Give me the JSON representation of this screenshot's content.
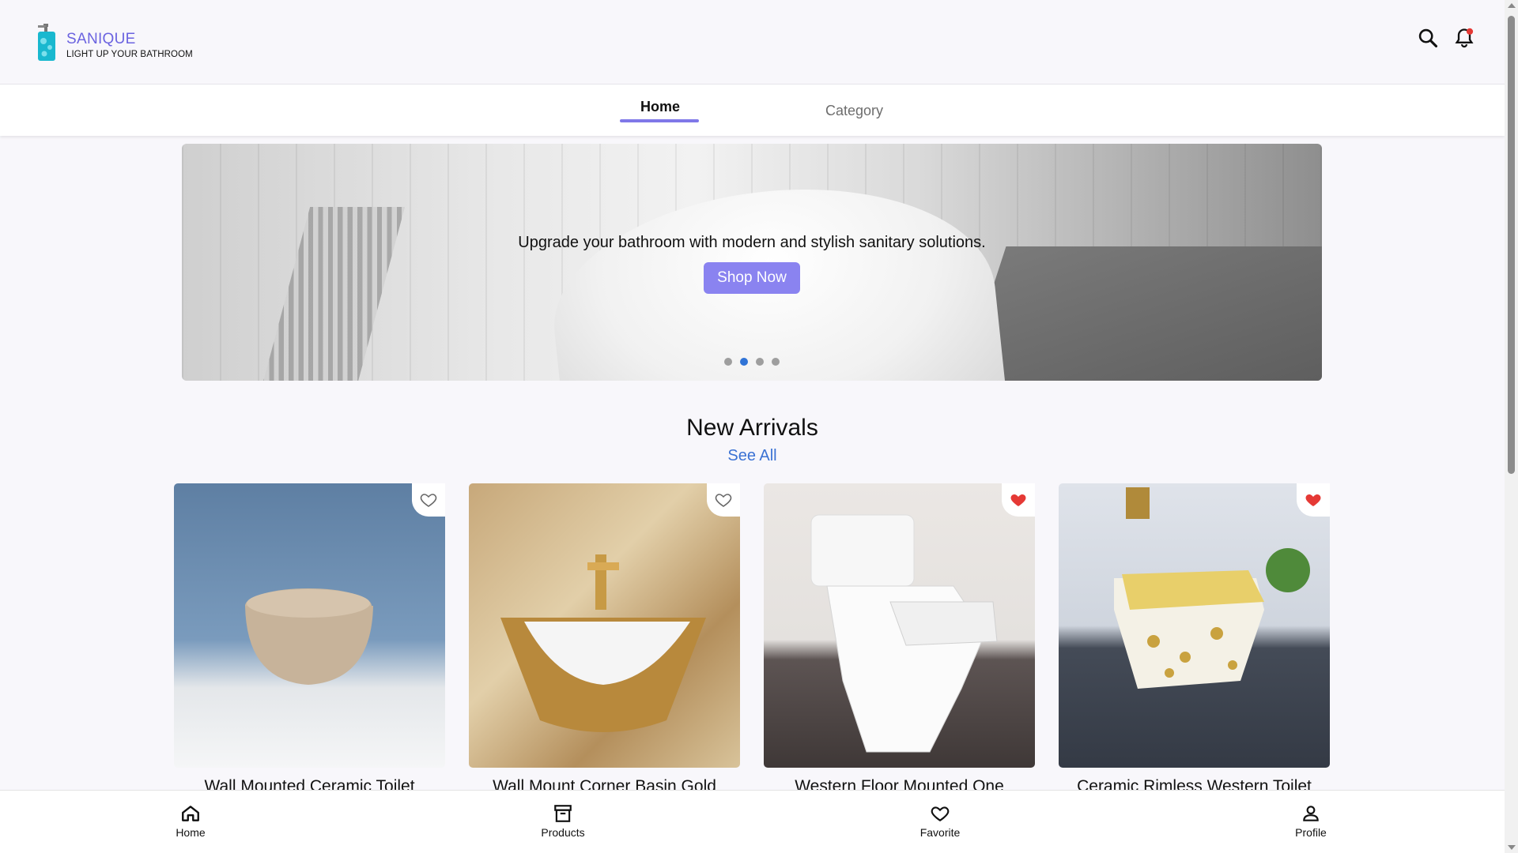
{
  "header": {
    "brand": "SANIQUE",
    "tagline": "LIGHT UP YOUR BATHROOM",
    "icons": [
      "search-icon",
      "bell-icon"
    ],
    "notification_dot_color": "#e53935"
  },
  "tabs": [
    {
      "label": "Home",
      "active": true
    },
    {
      "label": "Category",
      "active": false
    }
  ],
  "hero": {
    "text": "Upgrade your bathroom with modern and stylish sanitary solutions.",
    "button": "Shop Now",
    "slides": 4,
    "active_slide": 2
  },
  "new_arrivals": {
    "title": "New Arrivals",
    "see_all": "See All",
    "products": [
      {
        "name": "Wall Mounted Ceramic Toilet",
        "favorite": false
      },
      {
        "name": "Wall Mount Corner Basin Gold",
        "favorite": false
      },
      {
        "name": "Western Floor Mounted One",
        "favorite": true
      },
      {
        "name": "Ceramic Rimless Western Toilet",
        "favorite": true
      }
    ]
  },
  "bottom_nav": [
    {
      "label": "Home",
      "icon": "home-icon"
    },
    {
      "label": "Products",
      "icon": "archive-box-icon"
    },
    {
      "label": "Favorite",
      "icon": "heart-icon"
    },
    {
      "label": "Profile",
      "icon": "user-icon"
    }
  ],
  "colors": {
    "accent": "#7f78e8",
    "brand": "#6b63e0",
    "link": "#3b72d4",
    "favorite": "#e53935"
  }
}
